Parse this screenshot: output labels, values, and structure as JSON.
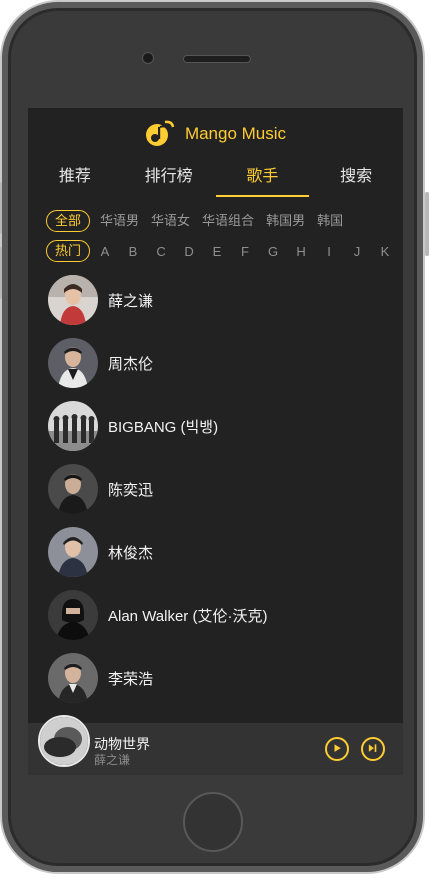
{
  "app": {
    "title": "Mango Music",
    "accent": "#ffcd32"
  },
  "tabs": [
    {
      "label": "推荐"
    },
    {
      "label": "排行榜"
    },
    {
      "label": "歌手"
    },
    {
      "label": "搜索"
    }
  ],
  "active_tab": "歌手",
  "categories": [
    "全部",
    "华语男",
    "华语女",
    "华语组合",
    "韩国男",
    "韩国"
  ],
  "active_category": "全部",
  "index": {
    "hot": "热门",
    "letters": [
      "A",
      "B",
      "C",
      "D",
      "E",
      "F",
      "G",
      "H",
      "I",
      "J",
      "K"
    ]
  },
  "singers": [
    {
      "name": "薛之谦"
    },
    {
      "name": "周杰伦"
    },
    {
      "name": "BIGBANG (빅뱅)"
    },
    {
      "name": "陈奕迅"
    },
    {
      "name": "林俊杰"
    },
    {
      "name": "Alan Walker (艾伦·沃克)"
    },
    {
      "name": "李荣浩"
    }
  ],
  "player": {
    "song": "动物世界",
    "singer": "薛之谦",
    "icons": [
      "play-icon",
      "next-icon"
    ]
  }
}
